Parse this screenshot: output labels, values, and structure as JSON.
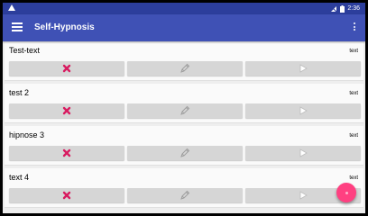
{
  "status_bar": {
    "time": "2:36",
    "icons": [
      "warning-icon",
      "no-sim-icon",
      "battery-icon"
    ]
  },
  "app_bar": {
    "title": "Self-Hypnosis",
    "menu_icon": "hamburger-menu-icon",
    "overflow_icon": "more-vert-icon"
  },
  "items": [
    {
      "title": "Test-text",
      "type": "text"
    },
    {
      "title": "test 2",
      "type": "text"
    },
    {
      "title": "hipnose 3",
      "type": "text"
    },
    {
      "title": "text 4",
      "type": "text"
    }
  ],
  "actions": {
    "delete_icon": "delete-x-icon",
    "edit_icon": "pencil-edit-icon",
    "play_icon": "play-icon"
  },
  "colors": {
    "primary": "#3f51b5",
    "primary_dark": "#2c3e9c",
    "accent": "#ff4081",
    "delete": "#d81b60"
  }
}
